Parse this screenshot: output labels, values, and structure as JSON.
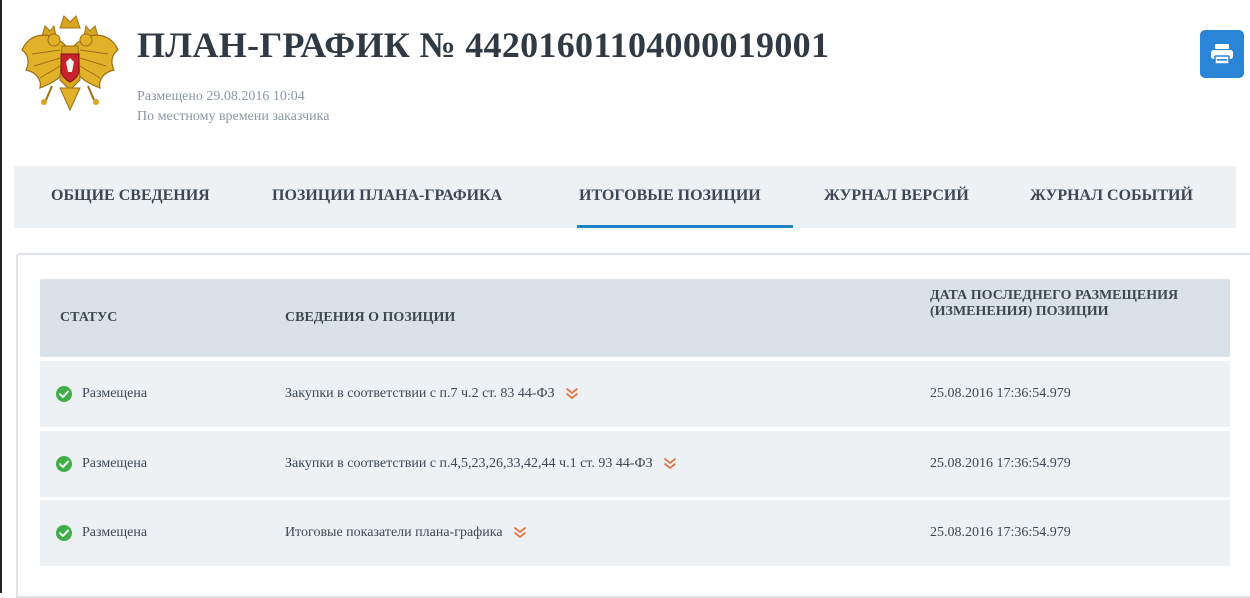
{
  "header": {
    "title": "ПЛАН-ГРАФИК № 44201601104000019001",
    "published": "Размещено 29.08.2016 10:04",
    "timezone_note": "По местному времени заказчика"
  },
  "tabs": [
    {
      "label": "ОБЩИЕ СВЕДЕНИЯ",
      "active": false
    },
    {
      "label": "ПОЗИЦИИ ПЛАНА-ГРАФИКА",
      "active": false
    },
    {
      "label": "ИТОГОВЫЕ ПОЗИЦИИ",
      "active": true
    },
    {
      "label": "ЖУРНАЛ ВЕРСИЙ",
      "active": false
    },
    {
      "label": "ЖУРНАЛ СОБЫТИЙ",
      "active": false
    }
  ],
  "table": {
    "columns": [
      "СТАТУС",
      "СВЕДЕНИЯ О ПОЗИЦИИ",
      "ДАТА ПОСЛЕДНЕГО РАЗМЕЩЕНИЯ (ИЗМЕНЕНИЯ) ПОЗИЦИИ"
    ],
    "rows": [
      {
        "status": "Размещена",
        "info": "Закупки в соответствии с п.7 ч.2 ст. 83 44-ФЗ",
        "date": "25.08.2016 17:36:54.979"
      },
      {
        "status": "Размещена",
        "info": "Закупки в соответствии с п.4,5,23,26,33,42,44 ч.1 ст. 93 44-ФЗ",
        "date": "25.08.2016 17:36:54.979"
      },
      {
        "status": "Размещена",
        "info": "Итоговые показатели плана-графика",
        "date": "25.08.2016 17:36:54.979"
      }
    ]
  },
  "icons": {
    "emblem": "russian-coat-of-arms",
    "print": "printer-icon",
    "status": "check-circle-icon",
    "expand": "double-chevron-down-icon"
  },
  "colors": {
    "accent": "#1e86c6",
    "print_button": "#2a85d6",
    "status_ok": "#3fae49",
    "chevron": "#e07a4a",
    "header_bg": "#d9e1e9",
    "row_bg": "#eef1f4"
  }
}
